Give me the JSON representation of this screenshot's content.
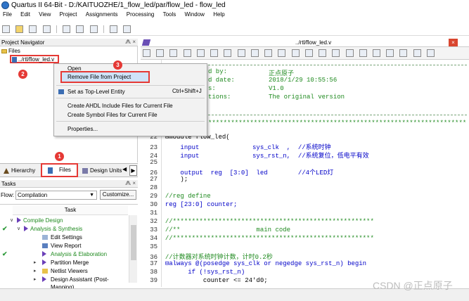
{
  "window": {
    "title": "Quartus II 64-Bit - D:/KAITUOZHE/1_flow_led/par/flow_led - flow_led"
  },
  "menu": [
    "File",
    "Edit",
    "View",
    "Project",
    "Assignments",
    "Processing",
    "Tools",
    "Window",
    "Help"
  ],
  "project_navigator": {
    "title": "Project Navigator",
    "controls": "⨇ ×",
    "folder": "Files",
    "file": "../rtl/flow_led.v"
  },
  "context_menu": {
    "open": "Open",
    "remove": "Remove File from Project",
    "set_top": "Set as Top-Level Entity",
    "set_top_shortcut": "Ctrl+Shift+J",
    "create_ahdl": "Create AHDL Include Files for Current File",
    "create_symbol": "Create Symbol Files for Current File",
    "properties": "Properties..."
  },
  "badges": [
    "1",
    "2",
    "3"
  ],
  "nav_tabs": {
    "hierarchy": "Hierarchy",
    "files": "Files",
    "design_units": "Design Units"
  },
  "tasks": {
    "title": "Tasks",
    "controls": "⨇ ×",
    "flow_label": "Flow:",
    "flow_value": "Compilation",
    "customize": "Customize...",
    "column": "Task",
    "rows": [
      {
        "label": "Compile Design",
        "check": false
      },
      {
        "label": "Analysis & Synthesis",
        "check": true
      },
      {
        "label": "Edit Settings",
        "check": false
      },
      {
        "label": "View Report",
        "check": false
      },
      {
        "label": "Analysis & Elaboration",
        "check": true
      },
      {
        "label": "Partition Merge",
        "check": false
      },
      {
        "label": "Netlist Viewers",
        "check": false
      },
      {
        "label": "Design Assistant (Post-Mapping)",
        "check": false
      }
    ]
  },
  "editor": {
    "title": "../rtl/flow_led.v",
    "close": "×",
    "header_lines": [
      [
        "d by:",
        "正点原子"
      ],
      [
        "d date:",
        "2018/1/29 10:55:56"
      ],
      [
        "s:",
        "V1.0"
      ],
      [
        "tions:",
        "The original version"
      ]
    ],
    "stars": "*********************************************************************",
    "lines": [
      {
        "n": "22",
        "text": "⊟module flow_led("
      },
      {
        "n": "23",
        "text": "    input              sys_clk  ,  //系统时钟"
      },
      {
        "n": "24",
        "text": "    input              sys_rst_n,  //系统复位，低电平有效"
      },
      {
        "n": "25",
        "text": ""
      },
      {
        "n": "26",
        "text": "    output  reg  [3:0]  led        //4个LED灯"
      },
      {
        "n": "27",
        "text": "    );"
      },
      {
        "n": "28",
        "text": ""
      },
      {
        "n": "29",
        "text": "//reg define"
      },
      {
        "n": "30",
        "text": "reg [23:0] counter;"
      },
      {
        "n": "31",
        "text": ""
      },
      {
        "n": "32",
        "text": "//*****************************************************"
      },
      {
        "n": "33",
        "text": "//**                    main code"
      },
      {
        "n": "34",
        "text": "//*****************************************************"
      },
      {
        "n": "35",
        "text": ""
      },
      {
        "n": "36",
        "text": "//计数器对系统时钟计数，计时0.2秒"
      },
      {
        "n": "37",
        "text": "⊟always @(posedge sys_clk or negedge sys_rst_n) begin"
      },
      {
        "n": "38",
        "text": "      if (!sys_rst_n)"
      },
      {
        "n": "39",
        "text": "          counter <= 24'd0;"
      }
    ]
  },
  "watermark": "CSDN @正点原子",
  "colors": {
    "badge": "#e53935",
    "highlight_box": "#e53935",
    "keyword": "#0000c8",
    "comment": "#1f8a1f"
  }
}
